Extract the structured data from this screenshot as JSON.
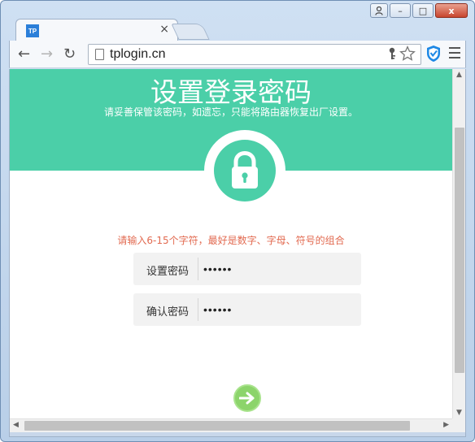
{
  "browser": {
    "tab_title": "",
    "tab_favicon_text": "TP",
    "tab_close": "×",
    "url": "tplogin.cn",
    "nav_back": "←",
    "nav_forward": "→",
    "nav_reload": "↻",
    "window_minimize": "–",
    "window_maximize": "□",
    "window_close": "x"
  },
  "page": {
    "title": "设置登录密码",
    "subtitle": "请妥善保管该密码，如遗忘，只能将路由器恢复出厂设置。",
    "hint": "请输入6-15个字符，最好是数字、字母、符号的组合",
    "fields": [
      {
        "label": "设置密码",
        "value": "••••••"
      },
      {
        "label": "确认密码",
        "value": "••••••"
      }
    ]
  },
  "colors": {
    "accent": "#4bcfa8",
    "hint": "#e26a50",
    "button": "#8cd46b"
  }
}
